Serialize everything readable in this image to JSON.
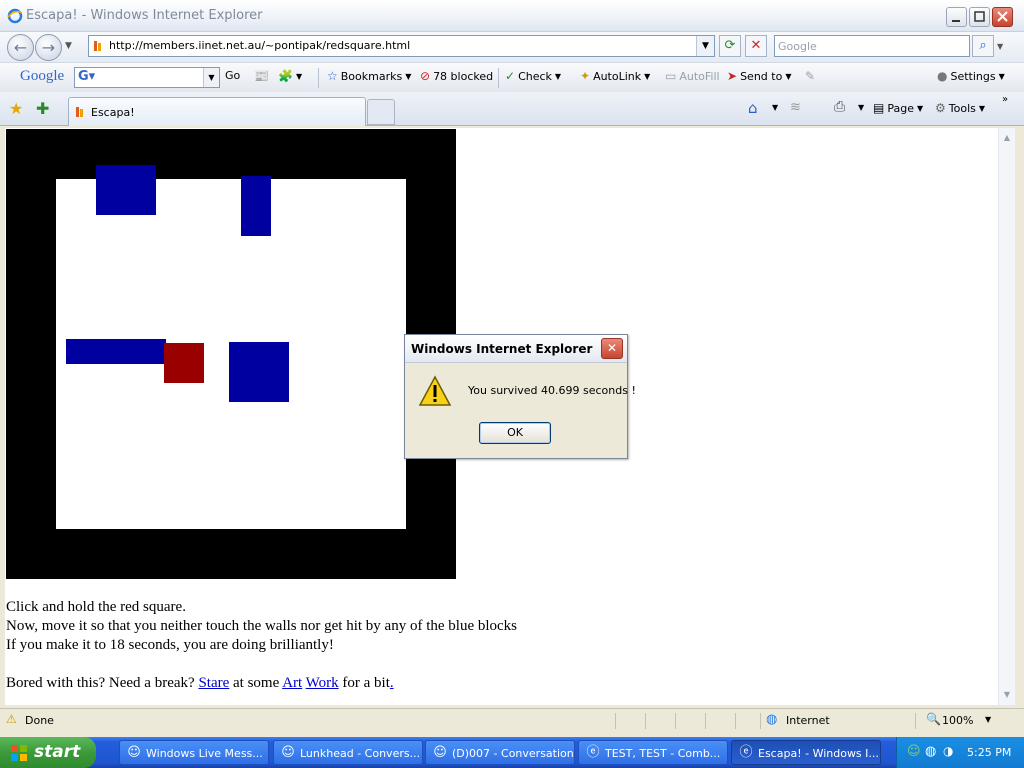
{
  "window": {
    "title": "Escapa! - Windows Internet Explorer"
  },
  "address": {
    "url": "http://members.iinet.net.au/~pontipak/redsquare.html"
  },
  "search": {
    "placeholder": "Google"
  },
  "google_toolbar": {
    "logo": "Google",
    "go": "Go",
    "bookmarks": "Bookmarks",
    "blocked": "78 blocked",
    "check": "Check",
    "autolink": "AutoLink",
    "autofill": "AutoFill",
    "sendto": "Send to",
    "settings": "Settings"
  },
  "tabs": [
    {
      "label": "Escapa!"
    }
  ],
  "command_bar": {
    "page": "Page",
    "tools": "Tools"
  },
  "page": {
    "lines": [
      "Click and hold the red square.",
      "Now, move it so that you neither touch the walls nor get hit by any of the blue blocks",
      "If you make it to 18 seconds, you are doing brilliantly!"
    ],
    "bored": {
      "pre": "Bored with this? Need a break? ",
      "link1": "Stare",
      "mid": " at some ",
      "link2": "Art",
      "space": " ",
      "link3": "Work",
      "post": " for a bit",
      "dot": "."
    }
  },
  "dialog": {
    "title": "Windows Internet Explorer",
    "message": "You survived 40.699 seconds !",
    "ok": "OK"
  },
  "status": {
    "text": "Done",
    "zone": "Internet",
    "zoom": "100%"
  },
  "taskbar": {
    "start": "start",
    "items": [
      {
        "label": "Windows Live Mess..."
      },
      {
        "label": "Lunkhead - Convers..."
      },
      {
        "label": "(D)007 - Conversation"
      },
      {
        "label": "TEST, TEST - Comb..."
      },
      {
        "label": "Escapa! - Windows I..."
      }
    ],
    "clock": "5:25 PM"
  },
  "colors": {
    "blue_block": "#0000a0",
    "red_square": "#990000",
    "taskbar": "#245edb"
  }
}
